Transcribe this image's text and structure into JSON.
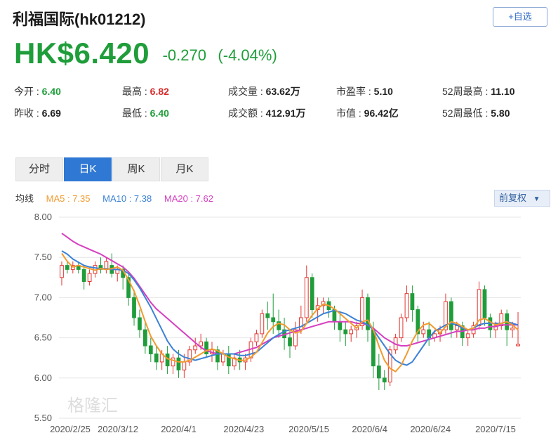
{
  "header": {
    "title": "利福国际(hk01212)",
    "watch_label": "+自选"
  },
  "quote": {
    "price": "HK$6.420",
    "change": "-0.270",
    "change_pct": "(-4.04%)"
  },
  "stats": [
    {
      "label": "今开 : ",
      "value": "6.40",
      "tone": "green"
    },
    {
      "label": "最高 : ",
      "value": "6.82",
      "tone": "red"
    },
    {
      "label": "成交量 : ",
      "value": "63.62万",
      "tone": ""
    },
    {
      "label": "市盈率 : ",
      "value": "5.10",
      "tone": ""
    },
    {
      "label": "52周最高 : ",
      "value": "11.10",
      "tone": ""
    },
    {
      "label": "昨收 : ",
      "value": "6.69",
      "tone": ""
    },
    {
      "label": "最低 : ",
      "value": "6.40",
      "tone": "green"
    },
    {
      "label": "成交额 : ",
      "value": "412.91万",
      "tone": ""
    },
    {
      "label": "市值 : ",
      "value": "96.42亿",
      "tone": ""
    },
    {
      "label": "52周最低 : ",
      "value": "5.80",
      "tone": ""
    }
  ],
  "tabs": [
    {
      "label": "分时",
      "active": false
    },
    {
      "label": "日K",
      "active": true
    },
    {
      "label": "周K",
      "active": false
    },
    {
      "label": "月K",
      "active": false
    }
  ],
  "ma": {
    "label": "均线",
    "ma5": "MA5 : 7.35",
    "ma10": "MA10 : 7.38",
    "ma20": "MA20 : 7.62",
    "adjust": "前复权"
  },
  "colors": {
    "up": "#e3342f",
    "down": "#1f9d3a",
    "ma5": "#f29a2e",
    "ma10": "#3b82d6",
    "ma20": "#d63fc0"
  },
  "chart_data": {
    "type": "candlestick",
    "ylim": [
      5.5,
      8.0
    ],
    "yticks": [
      "8.00",
      "7.50",
      "7.00",
      "6.50",
      "6.00",
      "5.50"
    ],
    "xlabels": [
      "2020/2/25",
      "2020/3/12",
      "2020/4/1",
      "2020/4/23",
      "2020/5/15",
      "2020/6/4",
      "2020/6/24",
      "2020/7/15"
    ],
    "watermark": "格隆汇",
    "candles": [
      [
        7.25,
        7.45,
        7.4,
        7.15
      ],
      [
        7.4,
        7.45,
        7.35,
        7.3
      ],
      [
        7.35,
        7.45,
        7.4,
        7.3
      ],
      [
        7.4,
        7.45,
        7.35,
        7.3
      ],
      [
        7.35,
        7.4,
        7.2,
        7.1
      ],
      [
        7.2,
        7.35,
        7.3,
        7.15
      ],
      [
        7.3,
        7.45,
        7.4,
        7.25
      ],
      [
        7.4,
        7.5,
        7.35,
        7.3
      ],
      [
        7.35,
        7.5,
        7.45,
        7.3
      ],
      [
        7.4,
        7.55,
        7.3,
        7.25
      ],
      [
        7.3,
        7.4,
        7.35,
        7.2
      ],
      [
        7.35,
        7.4,
        7.25,
        7.1
      ],
      [
        7.25,
        7.3,
        7.0,
        6.9
      ],
      [
        7.0,
        7.1,
        6.75,
        6.65
      ],
      [
        6.75,
        6.85,
        6.6,
        6.5
      ],
      [
        6.6,
        6.7,
        6.4,
        6.3
      ],
      [
        6.4,
        6.5,
        6.3,
        6.2
      ],
      [
        6.3,
        6.4,
        6.2,
        6.1
      ],
      [
        6.2,
        6.35,
        6.3,
        6.1
      ],
      [
        6.3,
        6.4,
        6.15,
        6.05
      ],
      [
        6.15,
        6.3,
        6.25,
        6.05
      ],
      [
        6.25,
        6.35,
        6.1,
        6.0
      ],
      [
        6.1,
        6.3,
        6.2,
        6.0
      ],
      [
        6.2,
        6.4,
        6.35,
        6.15
      ],
      [
        6.35,
        6.5,
        6.4,
        6.3
      ],
      [
        6.4,
        6.55,
        6.45,
        6.35
      ],
      [
        6.45,
        6.5,
        6.3,
        6.25
      ],
      [
        6.3,
        6.45,
        6.35,
        6.2
      ],
      [
        6.35,
        6.4,
        6.2,
        6.1
      ],
      [
        6.2,
        6.35,
        6.3,
        6.15
      ],
      [
        6.3,
        6.4,
        6.15,
        6.05
      ],
      [
        6.15,
        6.3,
        6.25,
        6.1
      ],
      [
        6.25,
        6.35,
        6.2,
        6.1
      ],
      [
        6.2,
        6.3,
        6.25,
        6.1
      ],
      [
        6.25,
        6.5,
        6.45,
        6.2
      ],
      [
        6.45,
        6.6,
        6.55,
        6.4
      ],
      [
        6.55,
        6.85,
        6.8,
        6.5
      ],
      [
        6.8,
        6.95,
        6.75,
        6.6
      ],
      [
        6.75,
        7.05,
        6.7,
        6.55
      ],
      [
        6.7,
        6.85,
        6.6,
        6.5
      ],
      [
        6.6,
        6.75,
        6.5,
        6.35
      ],
      [
        6.5,
        6.6,
        6.4,
        6.25
      ],
      [
        6.4,
        6.7,
        6.6,
        6.35
      ],
      [
        6.6,
        6.9,
        6.75,
        6.55
      ],
      [
        6.75,
        7.4,
        7.25,
        6.7
      ],
      [
        7.25,
        7.3,
        6.85,
        6.75
      ],
      [
        6.85,
        7.0,
        6.9,
        6.7
      ],
      [
        6.9,
        7.0,
        6.95,
        6.8
      ],
      [
        6.95,
        7.0,
        6.85,
        6.75
      ],
      [
        6.85,
        6.9,
        6.7,
        6.6
      ],
      [
        6.7,
        6.8,
        6.6,
        6.45
      ],
      [
        6.6,
        6.7,
        6.55,
        6.4
      ],
      [
        6.55,
        6.65,
        6.6,
        6.45
      ],
      [
        6.6,
        6.7,
        6.65,
        6.5
      ],
      [
        6.65,
        7.1,
        7.0,
        6.6
      ],
      [
        7.0,
        7.05,
        6.6,
        6.45
      ],
      [
        6.6,
        6.7,
        6.15,
        6.0
      ],
      [
        6.15,
        6.3,
        6.0,
        5.85
      ],
      [
        6.0,
        6.1,
        5.95,
        5.85
      ],
      [
        5.95,
        6.4,
        6.35,
        5.9
      ],
      [
        6.35,
        6.55,
        6.5,
        6.3
      ],
      [
        6.5,
        6.8,
        6.75,
        6.45
      ],
      [
        6.75,
        7.15,
        7.05,
        6.7
      ],
      [
        7.05,
        7.15,
        6.85,
        6.7
      ],
      [
        6.85,
        6.9,
        6.55,
        6.45
      ],
      [
        6.55,
        6.7,
        6.6,
        6.5
      ],
      [
        6.6,
        6.7,
        6.5,
        6.4
      ],
      [
        6.5,
        6.6,
        6.55,
        6.45
      ],
      [
        6.55,
        6.65,
        6.6,
        6.45
      ],
      [
        6.6,
        7.05,
        6.95,
        6.55
      ],
      [
        6.95,
        7.0,
        6.6,
        6.5
      ],
      [
        6.6,
        6.7,
        6.65,
        6.5
      ],
      [
        6.65,
        6.7,
        6.5,
        6.4
      ],
      [
        6.5,
        6.6,
        6.55,
        6.4
      ],
      [
        6.55,
        6.7,
        6.65,
        6.5
      ],
      [
        6.65,
        7.2,
        7.1,
        6.6
      ],
      [
        7.1,
        7.15,
        6.75,
        6.65
      ],
      [
        6.75,
        6.8,
        6.6,
        6.5
      ],
      [
        6.6,
        6.7,
        6.65,
        6.5
      ],
      [
        6.65,
        6.85,
        6.8,
        6.6
      ],
      [
        6.8,
        6.85,
        6.6,
        6.4
      ],
      [
        6.6,
        6.7,
        6.62,
        6.5
      ],
      [
        6.4,
        6.82,
        6.42,
        6.4
      ]
    ],
    "ma5": [
      7.55,
      7.45,
      7.38,
      7.4,
      7.38,
      7.36,
      7.34,
      7.36,
      7.35,
      7.36,
      7.38,
      7.34,
      7.22,
      7.08,
      6.9,
      6.7,
      6.52,
      6.4,
      6.3,
      6.24,
      6.22,
      6.2,
      6.2,
      6.22,
      6.26,
      6.3,
      6.34,
      6.36,
      6.34,
      6.3,
      6.26,
      6.24,
      6.22,
      6.22,
      6.26,
      6.32,
      6.44,
      6.56,
      6.64,
      6.68,
      6.66,
      6.6,
      6.56,
      6.58,
      6.68,
      6.78,
      6.86,
      6.92,
      6.9,
      6.86,
      6.8,
      6.74,
      6.68,
      6.62,
      6.7,
      6.72,
      6.6,
      6.4,
      6.22,
      6.12,
      6.08,
      6.16,
      6.3,
      6.46,
      6.58,
      6.66,
      6.68,
      6.62,
      6.56,
      6.64,
      6.7,
      6.68,
      6.64,
      6.6,
      6.62,
      6.72,
      6.74,
      6.7,
      6.66,
      6.68,
      6.7,
      6.66,
      6.6
    ],
    "ma10": [
      7.58,
      7.54,
      7.48,
      7.44,
      7.4,
      7.38,
      7.37,
      7.36,
      7.36,
      7.35,
      7.35,
      7.34,
      7.3,
      7.22,
      7.12,
      7.0,
      6.88,
      6.74,
      6.6,
      6.46,
      6.36,
      6.3,
      6.26,
      6.24,
      6.22,
      6.24,
      6.26,
      6.28,
      6.3,
      6.3,
      6.3,
      6.3,
      6.28,
      6.28,
      6.3,
      6.32,
      6.38,
      6.44,
      6.5,
      6.54,
      6.58,
      6.6,
      6.62,
      6.64,
      6.68,
      6.72,
      6.76,
      6.8,
      6.82,
      6.84,
      6.82,
      6.8,
      6.76,
      6.72,
      6.7,
      6.66,
      6.6,
      6.5,
      6.4,
      6.3,
      6.22,
      6.18,
      6.16,
      6.2,
      6.3,
      6.4,
      6.5,
      6.58,
      6.62,
      6.66,
      6.68,
      6.66,
      6.62,
      6.6,
      6.62,
      6.66,
      6.68,
      6.68,
      6.68,
      6.68,
      6.7,
      6.68,
      6.66
    ],
    "ma20": [
      7.8,
      7.75,
      7.7,
      7.66,
      7.63,
      7.6,
      7.57,
      7.54,
      7.5,
      7.46,
      7.42,
      7.38,
      7.32,
      7.24,
      7.14,
      7.04,
      6.94,
      6.86,
      6.8,
      6.74,
      6.68,
      6.62,
      6.56,
      6.5,
      6.44,
      6.38,
      6.34,
      6.32,
      6.3,
      6.3,
      6.3,
      6.3,
      6.32,
      6.34,
      6.36,
      6.38,
      6.42,
      6.46,
      6.5,
      6.52,
      6.54,
      6.56,
      6.58,
      6.6,
      6.62,
      6.64,
      6.66,
      6.68,
      6.7,
      6.7,
      6.7,
      6.7,
      6.7,
      6.68,
      6.68,
      6.66,
      6.62,
      6.56,
      6.5,
      6.46,
      6.42,
      6.4,
      6.4,
      6.42,
      6.44,
      6.46,
      6.48,
      6.5,
      6.52,
      6.54,
      6.56,
      6.58,
      6.58,
      6.6,
      6.6,
      6.62,
      6.62,
      6.64,
      6.64,
      6.66,
      6.66,
      6.66,
      6.66
    ]
  }
}
